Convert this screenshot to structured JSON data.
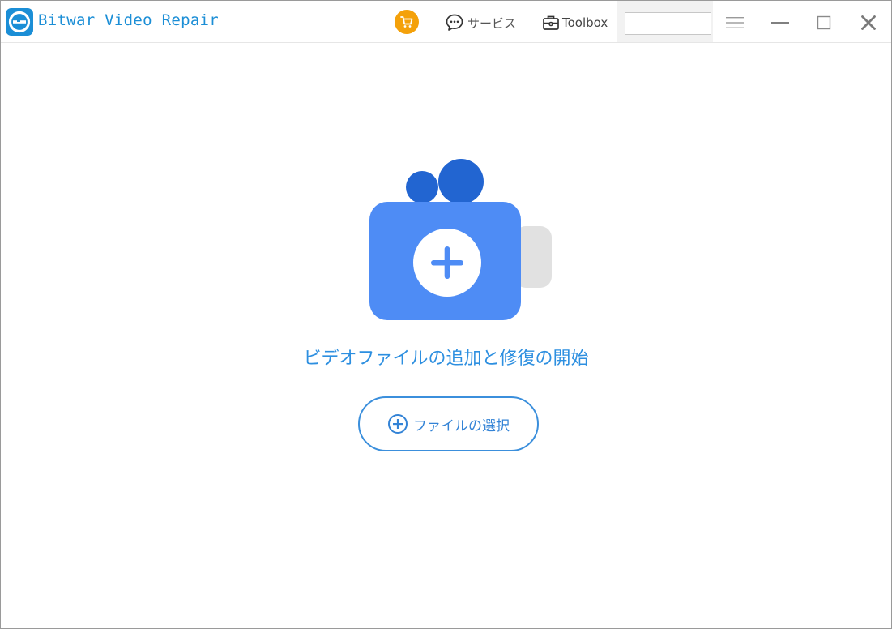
{
  "window": {
    "title": "Bitwar Video Repair"
  },
  "header": {
    "cart_icon": "shopping-cart-icon",
    "service_label": "サービス",
    "service_icon": "chat-bubble-icon",
    "toolbox_label": "Toolbox",
    "toolbox_icon": "toolbox-icon",
    "input_value": "",
    "menu_icon": "hamburger-menu-icon",
    "minimize_icon": "minimize-icon",
    "maximize_icon": "maximize-icon",
    "close_icon": "close-icon"
  },
  "main": {
    "illustration_icon": "video-camera-add-icon",
    "headline": "ビデオファイルの追加と修復の開始",
    "select_button_label": "ファイルの選択",
    "select_button_icon": "plus-circle-icon"
  },
  "colors": {
    "brand_blue": "#1b8ed6",
    "camera_blue": "#4e8cf5",
    "reel_blue": "#2265d1",
    "cart_orange": "#f4a10a"
  }
}
